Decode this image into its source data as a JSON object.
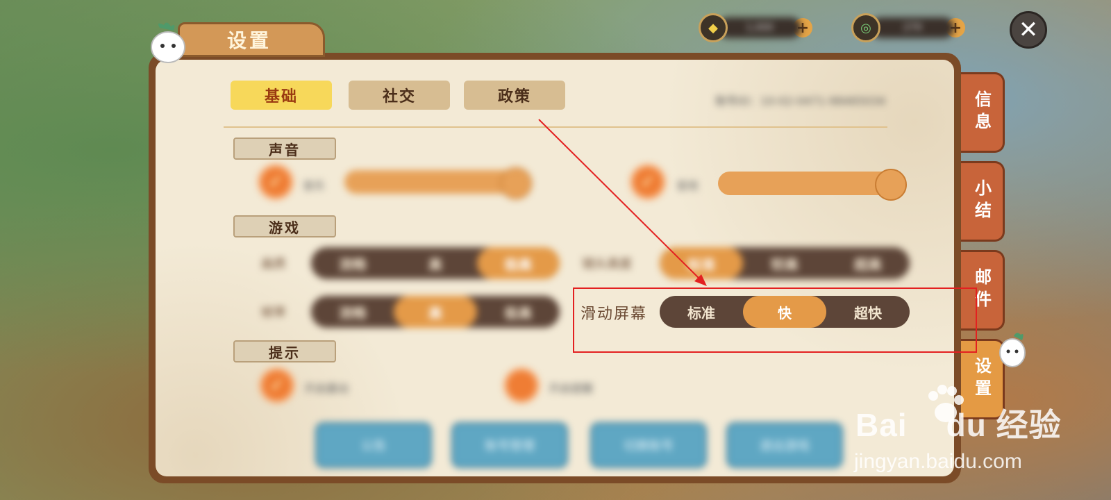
{
  "window_title": "设置",
  "currency": [
    {
      "icon": "gem-coin-icon",
      "amount": "1,000",
      "plus": "+"
    },
    {
      "icon": "copper-coin-icon",
      "amount": "279",
      "plus": "+"
    }
  ],
  "close_symbol": "✕",
  "tabs": [
    {
      "label": "基础",
      "active": true
    },
    {
      "label": "社交",
      "active": false
    },
    {
      "label": "政策",
      "active": false
    }
  ],
  "account_text": "账号ID：10-02-0471-98465034",
  "sections": {
    "sound": "声音",
    "game": "游戏",
    "tips": "提示"
  },
  "sound": {
    "music": {
      "label": "音乐",
      "checked": true,
      "volume": 1.0
    },
    "sfx": {
      "label": "音效",
      "checked": true,
      "volume": 1.0
    }
  },
  "game": {
    "quality": {
      "label": "画质",
      "options": [
        "流畅",
        "高",
        "极高"
      ],
      "selected": 2
    },
    "frame": {
      "label": "帧率",
      "options": [
        "流畅",
        "高",
        "极高"
      ],
      "selected": 1
    },
    "view_height": {
      "label": "镜头高度",
      "options": [
        "标准",
        "较高",
        "超高"
      ],
      "selected": 0
    },
    "swipe": {
      "label": "滑动屏幕",
      "options": [
        "标准",
        "快",
        "超快"
      ],
      "selected": 1
    }
  },
  "tips": {
    "tip1": {
      "label": "开启震动",
      "checked": true
    },
    "tip2": {
      "label": "开启提醒",
      "checked": false
    }
  },
  "buttons": [
    "公告",
    "账号管理",
    "切换账号",
    "退出游戏"
  ],
  "side_tabs": [
    {
      "label": "信息",
      "active": false
    },
    {
      "label": "小结",
      "active": false
    },
    {
      "label": "邮件",
      "active": false
    },
    {
      "label": "设置",
      "active": true
    }
  ],
  "watermark": {
    "brand": "Bai",
    "brand2": "du",
    "cn": "经验",
    "url": "jingyan.baidu.com"
  },
  "colors": {
    "annotation": "#e32020",
    "accent": "#e49a48",
    "panel": "#f3ead6"
  }
}
